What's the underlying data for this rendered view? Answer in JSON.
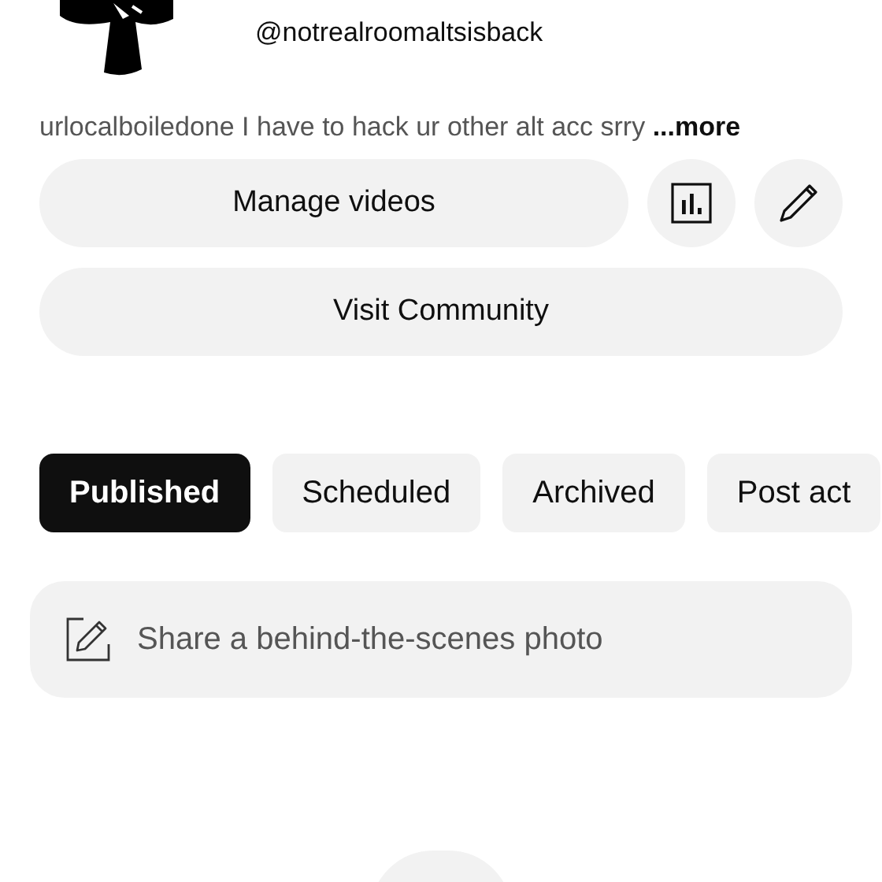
{
  "profile": {
    "handle": "@notrealroomaltsisback"
  },
  "bio": {
    "text": "urlocalboiledone I have to hack ur other alt acc srry",
    "more": "...more"
  },
  "actions": {
    "primary": "Manage videos",
    "secondary": "Visit Community"
  },
  "chips": [
    {
      "label": "Published",
      "selected": true
    },
    {
      "label": "Scheduled",
      "selected": false
    },
    {
      "label": "Archived",
      "selected": false
    },
    {
      "label": "Post act",
      "selected": false
    }
  ],
  "composer": {
    "placeholder": "Share a behind-the-scenes photo"
  }
}
